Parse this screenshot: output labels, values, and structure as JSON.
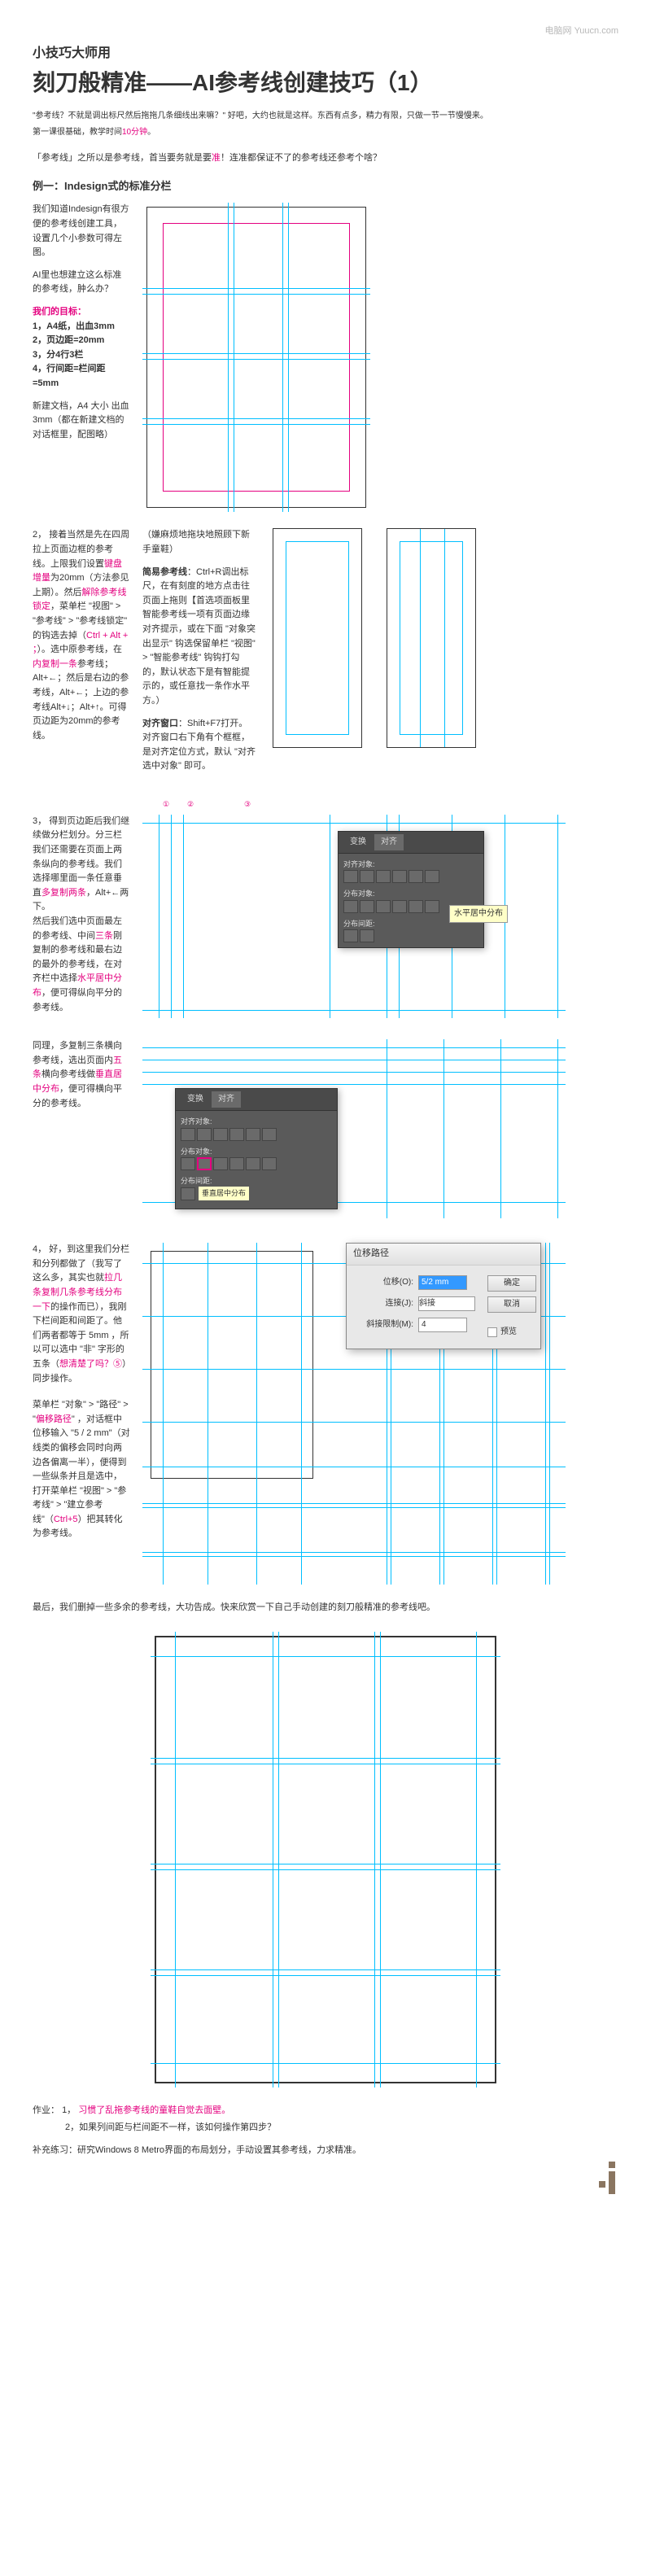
{
  "header_right": "电脑网 Yuucn.com",
  "subtitle": "小技巧大师用",
  "title": "刻刀般精准——AI参考线创建技巧（1）",
  "intro": "\"参考线？不就是调出标尺然后拖拖几条细线出来嘛？\" 好吧，大约也就是这样。东西有点多，精力有限，只做一节一节慢慢来。",
  "intro_note_prefix": "第一课很基础，教学时间",
  "intro_note_red": "10分钟",
  "intro_note_suffix": "。",
  "pre_text_1": "「参考线」之所以是参考线，首当要务就是要",
  "pre_text_red": "准",
  "pre_text_2": "！连准都保证不了的参考线还参考个啥？",
  "example_title": "例一：Indesign式的标准分栏",
  "p1a": "我们知道Indesign有很方便的参考线创建工具，设置几个小参数可得左图。",
  "p1b": "AI里也想建立这么标准的参考线，肿么办？",
  "goals_title": "我们的目标：",
  "goals": [
    "1，A4纸，出血3mm",
    "2，页边距=20mm",
    "3，分4行3栏",
    "4，行间距=栏间距=5mm"
  ],
  "p1c": "新建文档，A4 大小 出血 3mm（都在新建文档的对话框里，配图略）",
  "step2_num": "2，",
  "p2a_1": "接着当然是先在四周拉上页面边框的参考线。上限我们设置",
  "p2a_pink1": "键盘增量",
  "p2a_2": "为20mm（方法参见上期）。然后",
  "p2a_pink2": "解除参考线锁定",
  "p2a_3": "，菜单栏 \"视图\" > \"参考线\" > \"参考线锁定\" 的钩选去掉（",
  "p2a_pink3": "Ctrl + Alt + ；",
  "p2a_4": "）。选中原参考线，在",
  "p2a_pink4": "内复制一条",
  "p2a_5": "参考线；Alt+←；然后是右边的参考线，Alt+←；上边的参考线Alt+↓；Alt+↑。可得页边距为20mm的参考线。",
  "p2_mid_title": "（嫌麻烦地拖块地照顾下新手童鞋）",
  "p2_mid_1_bold": "简易参考线",
  "p2_mid_1": "：Ctrl+R调出标尺，在有刻度的地方点击往页面上拖则【首选项面板里智能参考线一项有页面边缘对齐提示，或在下面 \"对象突出显示\" 钩选保留单栏 \"视图\" > \"智能参考线\" 钩钩打勾的，默认状态下是有智能提示的，或任意找一条作水平方。）",
  "p2_mid_2_bold": "对齐窗口",
  "p2_mid_2": "：Shift+F7打开。对齐窗口右下角有个框框，是对齐定位方式，默认 \"对齐选中对象\" 即可。",
  "step3_num": "3，",
  "p3a_1": "得到页边距后我们继续做分栏划分。分三栏我们还需要在页面上两条纵向的参考线。我们选择哪里面一条任意垂直",
  "p3a_pink1": "多复制两条",
  "p3a_2": "，Alt+←两下。",
  "p3b_1": "然后我们选中页面最左的参考线、中间",
  "p3b_pink1": "三条",
  "p3b_2": "刚复制的参考线和最右边的最外的参考线，在对齐栏中选择",
  "p3b_pink2": "水平居中分布",
  "p3b_3": "，便可得纵向平分的参考线。",
  "p3c_1": "同理，多复制三条横向参考线，选出页面内",
  "p3c_pink1": "五条",
  "p3c_2": "横向参考线做",
  "p3c_pink2": "垂直居中分布",
  "p3c_3": "，便可得横向平分的参考线。",
  "panel1": {
    "tab1": "变换",
    "tab2": "对齐",
    "row1": "对齐对象:",
    "row2": "分布对象:",
    "row3": "分布间距:",
    "tooltip": "水平居中分布"
  },
  "panel2": {
    "tab1": "变换",
    "tab2": "对齐",
    "row1": "对齐对象:",
    "row2": "分布对象:",
    "row3": "分布间距:",
    "highlight": "垂直居中分布"
  },
  "step4_num": "4，",
  "p4a_1": "好，到这里我们分栏和分列都做了（我写了这么多，其实也就",
  "p4a_pink1": "拉几条复制几条参考线分布一下",
  "p4a_2": "的操作而已），我刚下栏间距和间距了。他们两者都等于 5mm ，所以可以选中 \"非\" 字形的五条（",
  "p4a_pink2": "想清楚了吗？⑤",
  "p4a_3": "）同步操作。",
  "p4b_1": "菜单栏 \"对象\" > \"路径\" > \"",
  "p4b_pink1": "偏移路径",
  "p4b_2": "\" ，对话框中位移输入 \"5 / 2 mm\"（对线类的偏移会同时向两边各偏离一半），便得到一些纵条并且是选中，打开菜单栏 \"视图\" > \"参考线\" > \"建立参考线\"（",
  "p4b_pink2": "Ctrl+5",
  "p4b_3": "）把其转化为参考线。",
  "dialog": {
    "title": "位移路径",
    "offset_label": "位移(O):",
    "offset_value": "5/2 mm",
    "join_label": "连接(J):",
    "join_value": "斜接",
    "limit_label": "斜接限制(M):",
    "limit_value": "4",
    "ok": "确定",
    "cancel": "取消",
    "preview": "预览"
  },
  "final": "最后，我们删掉一些多余的参考线，大功告成。快来欣赏一下自己手动创建的刻刀般精准的参考线吧。",
  "homework_label": "作业：",
  "hw1_num": "1，",
  "hw1_red": "习惯了乱拖参考线的童鞋自觉去面壁。",
  "hw2": "2，如果列间距与栏间距不一样，该如何操作第四步？",
  "extra": "补充练习：研究Windows 8 Metro界面的布局划分，手动设置其参考线，力求精准。"
}
